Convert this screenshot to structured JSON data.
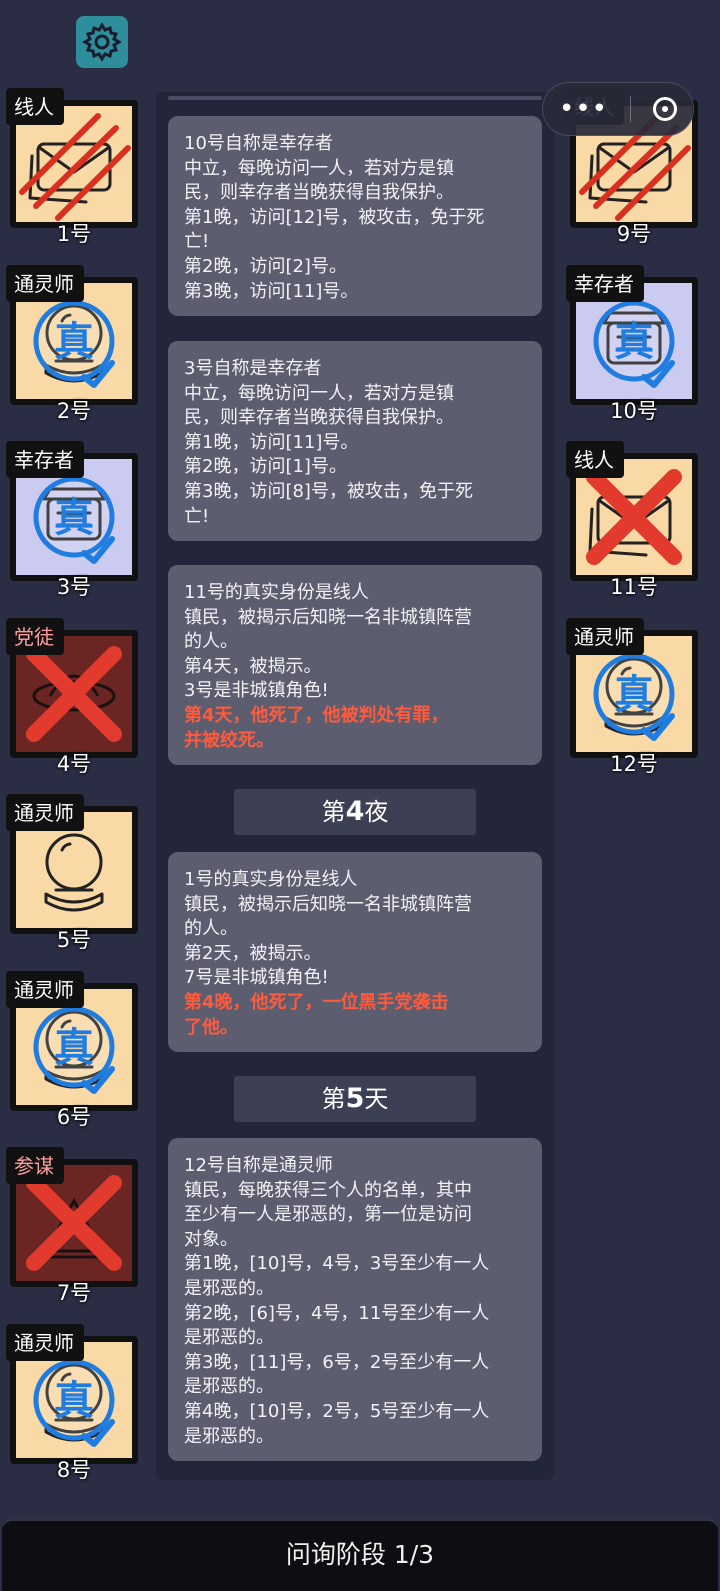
{
  "left_players": [
    {
      "role": "线人",
      "number": "1号",
      "icon": "informant-envelope-icon",
      "state": "slashed"
    },
    {
      "role": "通灵师",
      "number": "2号",
      "icon": "medium-crystal-ball-icon",
      "state": "verified"
    },
    {
      "role": "幸存者",
      "number": "3号",
      "icon": "survivor-icon",
      "state": "verified"
    },
    {
      "role": "党徒",
      "number": "4号",
      "icon": "cultist-icon",
      "state": "dead"
    },
    {
      "role": "通灵师",
      "number": "5号",
      "icon": "medium-crystal-ball-icon",
      "state": "normal"
    },
    {
      "role": "通灵师",
      "number": "6号",
      "icon": "medium-crystal-ball-icon",
      "state": "verified"
    },
    {
      "role": "参谋",
      "number": "7号",
      "icon": "advisor-icon",
      "state": "dead"
    },
    {
      "role": "通灵师",
      "number": "8号",
      "icon": "medium-crystal-ball-icon",
      "state": "verified"
    }
  ],
  "right_players": [
    {
      "role": "线人",
      "number": "9号",
      "icon": "informant-envelope-icon",
      "state": "slashed"
    },
    {
      "role": "幸存者",
      "number": "10号",
      "icon": "survivor-icon",
      "state": "verified"
    },
    {
      "role": "线人",
      "number": "11号",
      "icon": "informant-envelope-icon",
      "state": "dead"
    },
    {
      "role": "通灵师",
      "number": "12号",
      "icon": "medium-crystal-ball-icon",
      "state": "verified"
    }
  ],
  "verified_mark": "真",
  "messages": [
    {
      "lines": [
        "10号自称是幸存者",
        "中立，每晚访问一人，若对方是镇",
        "民，则幸存者当晚获得自我保护。",
        "第1晚，访问[12]号，被攻击，免于死",
        "亡!",
        "第2晚，访问[2]号。",
        "第3晚，访问[11]号。"
      ],
      "red": []
    },
    {
      "lines": [
        "3号自称是幸存者",
        "中立，每晚访问一人，若对方是镇",
        "民，则幸存者当晚获得自我保护。",
        "第1晚，访问[11]号。",
        "第2晚，访问[1]号。",
        "第3晚，访问[8]号，被攻击，免于死",
        "亡!"
      ],
      "red": []
    },
    {
      "lines": [
        "11号的真实身份是线人",
        "镇民，被揭示后知晓一名非城镇阵营",
        "的人。",
        "第4天，被揭示。",
        "3号是非城镇角色!"
      ],
      "red": [
        "第4天，他死了，他被判处有罪，",
        "并被绞死。"
      ]
    },
    {
      "lines": [
        "1号的真实身份是线人",
        "镇民，被揭示后知晓一名非城镇阵营",
        "的人。",
        "第2天，被揭示。",
        "7号是非城镇角色!"
      ],
      "red": [
        "第4晚，他死了，一位黑手党袭击",
        "了他。"
      ]
    },
    {
      "lines": [
        "12号自称是通灵师",
        "镇民，每晚获得三个人的名单，其中",
        "至少有一人是邪恶的，第一位是访问",
        "对象。",
        "第1晚，[10]号，4号，3号至少有一人",
        "是邪恶的。",
        "第2晚，[6]号，4号，11号至少有一人",
        "是邪恶的。",
        "第3晚，[11]号，6号，2号至少有一人",
        "是邪恶的。",
        "第4晚，[10]号，2号，5号至少有一人",
        "是邪恶的。"
      ],
      "red": []
    }
  ],
  "dividers": [
    {
      "prefix": "第",
      "num": "4",
      "suffix": "夜"
    },
    {
      "prefix": "第",
      "num": "5",
      "suffix": "天"
    }
  ],
  "capsule": {
    "more": "•••"
  },
  "bottom_bar": {
    "label": "问询阶段 1/3"
  },
  "colors": {
    "background": "#2b2d45",
    "town": "#f9d9a6",
    "survivor": "#cbcaf0",
    "dead": "#6b2624",
    "red_text": "#ff5a3c",
    "verified_blue": "#1f7de0",
    "cross_red": "#e23a2c"
  }
}
